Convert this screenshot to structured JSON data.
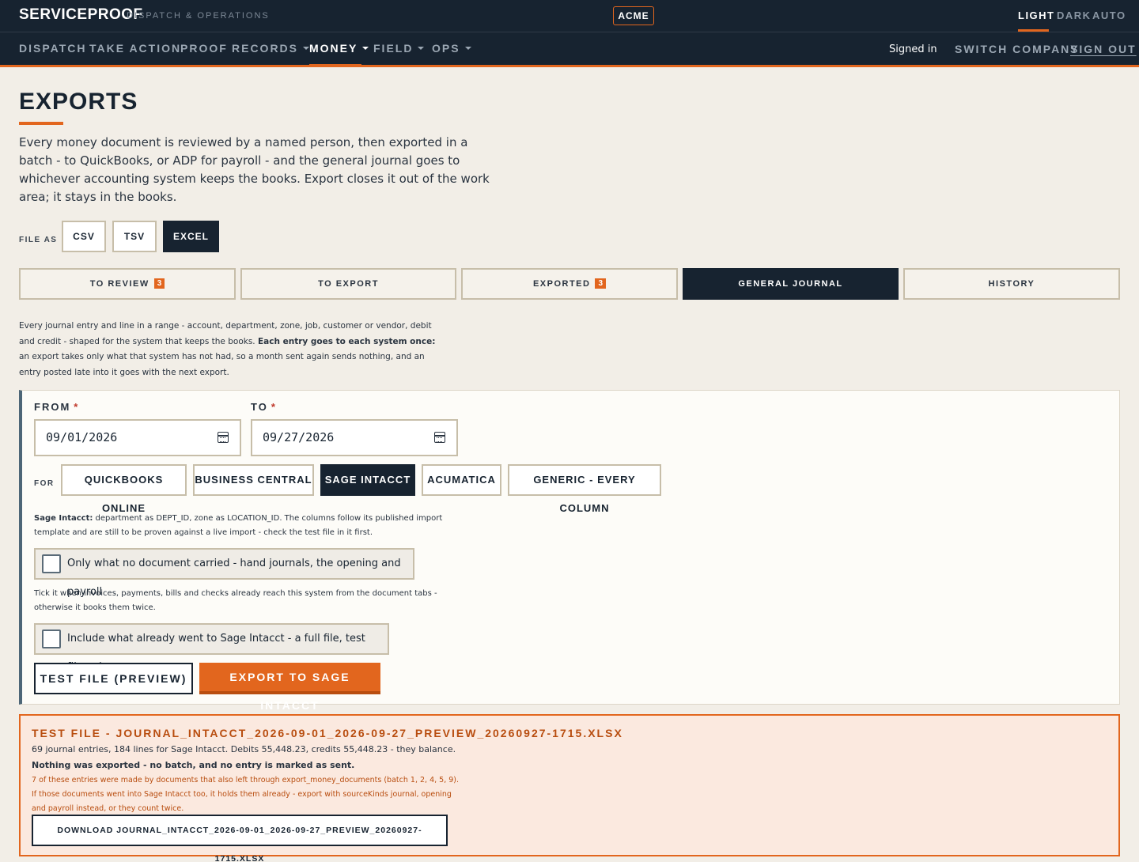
{
  "header": {
    "brand": "SERVICEPROOF",
    "brand_sub": "DISPATCH & OPERATIONS",
    "company": "ACME",
    "theme": [
      "LIGHT",
      "DARK",
      "AUTO"
    ]
  },
  "nav": {
    "items": [
      "DISPATCH",
      "TAKE ACTION",
      "PROOF",
      "RECORDS",
      "MONEY",
      "FIELD",
      "OPS"
    ],
    "active": "MONEY",
    "signed_in": "Signed in",
    "switch_company": "SWITCH COMPANY",
    "sign_out": "SIGN OUT"
  },
  "page": {
    "title": "EXPORTS",
    "intro": "Every money document is reviewed by a named person, then exported in a batch - to QuickBooks, or ADP for payroll - and the general journal goes to whichever accounting system keeps the books. Export closes it out of the work area; it stays in the books."
  },
  "file_as": {
    "label": "FILE AS",
    "options": [
      "CSV",
      "TSV",
      "EXCEL"
    ],
    "selected": "EXCEL"
  },
  "tabs": [
    {
      "label": "TO REVIEW",
      "count": "3"
    },
    {
      "label": "TO EXPORT"
    },
    {
      "label": "EXPORTED",
      "count": "3"
    },
    {
      "label": "GENERAL JOURNAL"
    },
    {
      "label": "HISTORY"
    }
  ],
  "active_tab": "GENERAL JOURNAL",
  "journal": {
    "help_a": "Every journal entry and line in a range - account, department, zone, job, customer or vendor, debit and credit - shaped for the system that keeps the books. ",
    "help_b": "Each entry goes to each system once:",
    "help_c": " an export takes only what that system has not had, so a month sent again sends nothing, and an entry posted late into it goes with the next export.",
    "from_label": "FROM",
    "from_value": "09/01/2026",
    "to_label": "TO",
    "to_value": "09/27/2026",
    "for_label": "FOR",
    "systems": [
      "QUICKBOOKS ONLINE",
      "BUSINESS CENTRAL",
      "SAGE INTACCT",
      "ACUMATICA",
      "GENERIC - EVERY COLUMN"
    ],
    "selected_system": "SAGE INTACCT",
    "system_note_name": "Sage Intacct:",
    "system_note": " department as DEPT_ID, zone as LOCATION_ID. The columns follow its published import template and are still to be proven against a live import - check the test file in it first.",
    "check1_label": "Only what no document carried - hand journals, the opening and payroll",
    "check1_checked": false,
    "check1_help": "Tick it when invoices, payments, bills and checks already reach this system from the document tabs - otherwise it books them twice.",
    "check2_label": "Include what already went to Sage Intacct - a full file, test file only",
    "check2_checked": false,
    "test_button": "TEST FILE (PREVIEW)",
    "export_button": "EXPORT TO SAGE INTACCT"
  },
  "result": {
    "title": "TEST FILE - JOURNAL_INTACCT_2026-09-01_2026-09-27_PREVIEW_20260927-1715.XLSX",
    "summary_a": "69 journal entries, 184 lines for Sage Intacct. Debits 55,448.23, credits 55,448.23 - they balance. ",
    "summary_b": "Nothing was exported - no batch, and no entry is marked as sent.",
    "warning": "7 of these entries were made by documents that also left through export_money_documents (batch 1, 2, 4, 5, 9). If those documents went into Sage Intacct too, it holds them already - export with sourceKinds journal, opening and payroll instead, or they count twice.",
    "download": "DOWNLOAD JOURNAL_INTACCT_2026-09-01_2026-09-27_PREVIEW_20260927-1715.XLSX"
  },
  "colors": {
    "navy": "#172330",
    "accent": "#e2661e",
    "background": "#f2eee7"
  }
}
